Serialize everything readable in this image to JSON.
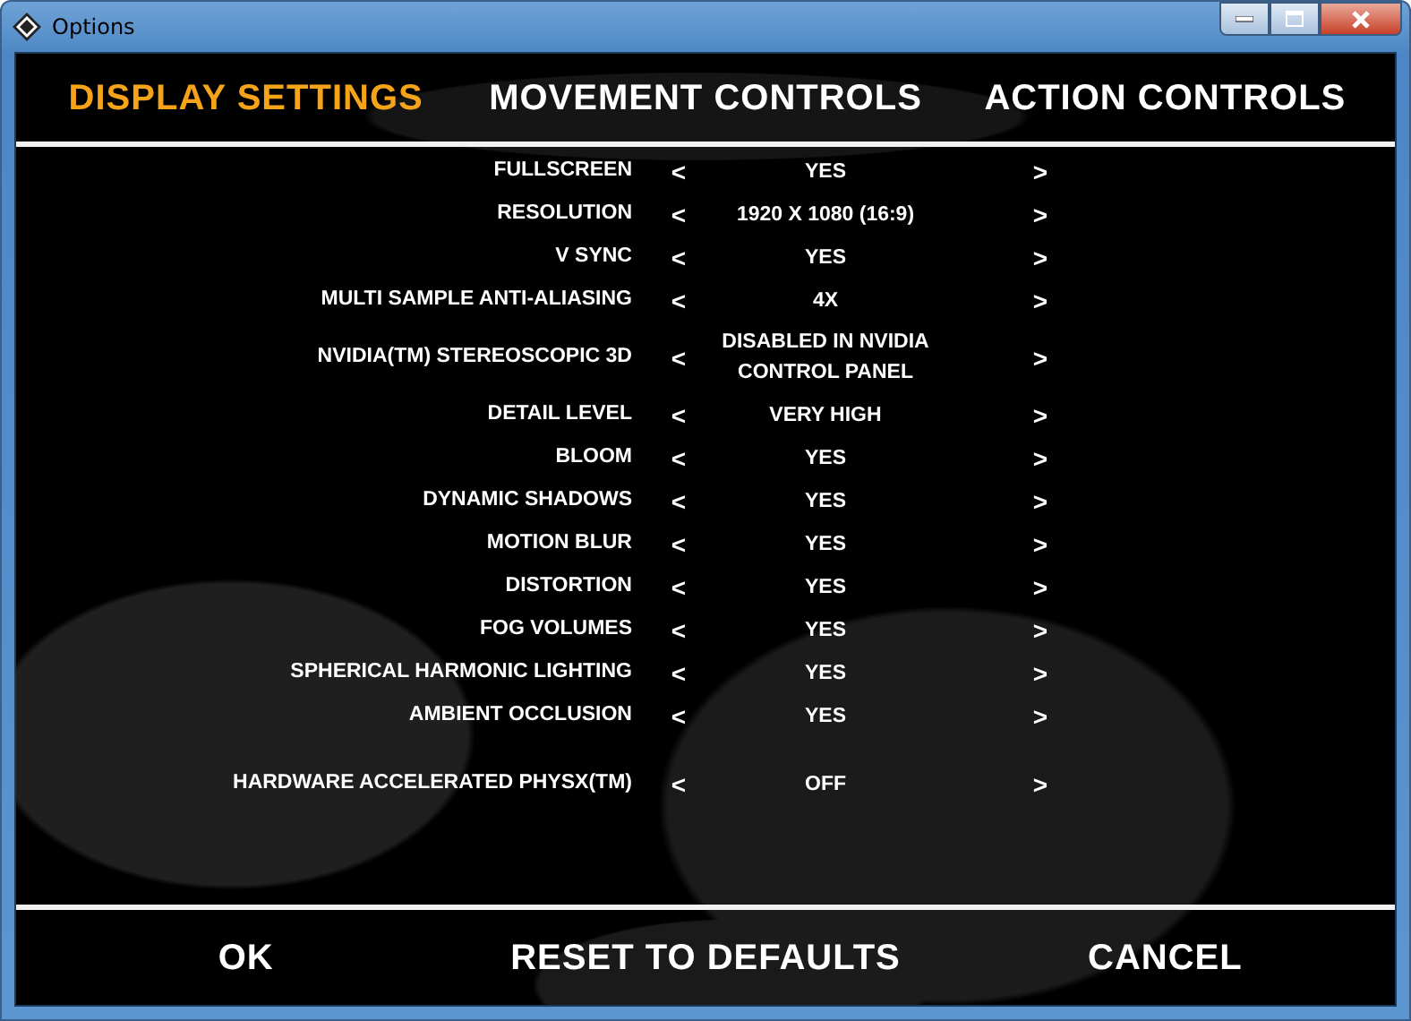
{
  "window": {
    "title": "Options"
  },
  "tabs": [
    {
      "label": "DISPLAY SETTINGS",
      "selected": true
    },
    {
      "label": "MOVEMENT CONTROLS",
      "selected": false
    },
    {
      "label": "ACTION CONTROLS",
      "selected": false
    }
  ],
  "setting_groups": [
    {
      "items": [
        {
          "label": "FULLSCREEN",
          "prev": "<",
          "value": "YES",
          "next": ">"
        },
        {
          "label": "RESOLUTION",
          "prev": "<",
          "value": "1920 X 1080 (16:9)",
          "next": ">"
        },
        {
          "label": "V SYNC",
          "prev": "<",
          "value": "YES",
          "next": ">"
        },
        {
          "label": "MULTI SAMPLE ANTI-ALIASING",
          "prev": "<",
          "value": "4X",
          "next": ">"
        },
        {
          "label": "NVIDIA(TM) STEREOSCOPIC 3D",
          "prev": "<",
          "value": "DISABLED IN NVIDIA CONTROL PANEL",
          "next": ">"
        },
        {
          "label": "DETAIL LEVEL",
          "prev": "<",
          "value": "VERY HIGH",
          "next": ">"
        },
        {
          "label": "BLOOM",
          "prev": "<",
          "value": "YES",
          "next": ">"
        },
        {
          "label": "DYNAMIC SHADOWS",
          "prev": "<",
          "value": "YES",
          "next": ">"
        },
        {
          "label": "MOTION BLUR",
          "prev": "<",
          "value": "YES",
          "next": ">"
        },
        {
          "label": "DISTORTION",
          "prev": "<",
          "value": "YES",
          "next": ">"
        },
        {
          "label": "FOG VOLUMES",
          "prev": "<",
          "value": "YES",
          "next": ">"
        },
        {
          "label": "SPHERICAL HARMONIC LIGHTING",
          "prev": "<",
          "value": "YES",
          "next": ">"
        },
        {
          "label": "AMBIENT OCCLUSION",
          "prev": "<",
          "value": "YES",
          "next": ">"
        }
      ]
    },
    {
      "items": [
        {
          "label": "HARDWARE ACCELERATED PHYSX(TM)",
          "prev": "<",
          "value": "OFF",
          "next": ">"
        }
      ]
    }
  ],
  "buttons": [
    "OK",
    "RESET TO DEFAULTS",
    "CANCEL"
  ]
}
